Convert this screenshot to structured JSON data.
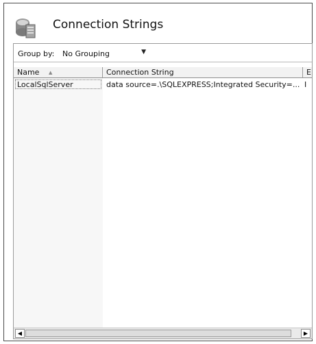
{
  "page": {
    "title": "Connection Strings"
  },
  "icons": {
    "header": "connection-strings-icon",
    "sort": "sort-ascending-icon",
    "scroll_left": "scroll-left-icon",
    "scroll_right": "scroll-right-icon"
  },
  "toolbar": {
    "group_by_label": "Group by:",
    "group_by_value": "No Grouping"
  },
  "table": {
    "columns": [
      "Name",
      "Connection String",
      "E"
    ],
    "rows": [
      {
        "name": "LocalSqlServer",
        "connection_string": "data source=.\\SQLEXPRESS;Integrated Security=...",
        "extra": "I"
      }
    ]
  }
}
